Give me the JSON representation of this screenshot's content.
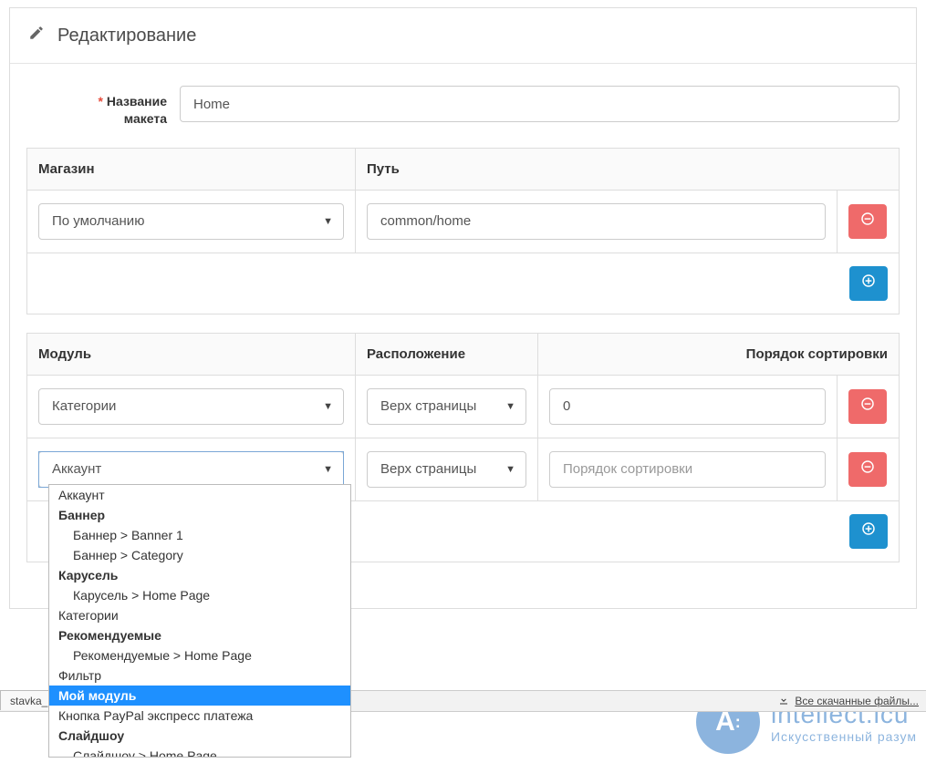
{
  "header": {
    "title": "Редактирование"
  },
  "form": {
    "name_label_line1": "Название",
    "name_label_line2": "макета",
    "name_value": "Home"
  },
  "routes": {
    "headers": {
      "store": "Магазин",
      "path": "Путь"
    },
    "rows": [
      {
        "store": "По умолчанию",
        "path": "common/home"
      }
    ]
  },
  "modules": {
    "headers": {
      "module": "Модуль",
      "position": "Расположение",
      "sort": "Порядок сортировки"
    },
    "rows": [
      {
        "module": "Категории",
        "position": "Верх страницы",
        "sort": "0"
      },
      {
        "module": "Аккаунт",
        "position": "Верх страницы",
        "sort": "",
        "sort_placeholder": "Порядок сортировки"
      }
    ]
  },
  "dropdown": {
    "options": [
      {
        "label": "Аккаунт",
        "bold": false,
        "indent": false
      },
      {
        "label": "Баннер",
        "bold": true,
        "indent": false
      },
      {
        "label": "Баннер > Banner 1",
        "bold": false,
        "indent": true
      },
      {
        "label": "Баннер > Category",
        "bold": false,
        "indent": true
      },
      {
        "label": "Карусель",
        "bold": true,
        "indent": false
      },
      {
        "label": "Карусель > Home Page",
        "bold": false,
        "indent": true
      },
      {
        "label": "Категории",
        "bold": false,
        "indent": false
      },
      {
        "label": "Рекомендуемые",
        "bold": true,
        "indent": false
      },
      {
        "label": "Рекомендуемые > Home Page",
        "bold": false,
        "indent": true
      },
      {
        "label": "Фильтр",
        "bold": false,
        "indent": false
      },
      {
        "label": "Мой модуль",
        "bold": true,
        "indent": false,
        "selected": true
      },
      {
        "label": "Кнопка PayPal экспресс платежа",
        "bold": false,
        "indent": false
      },
      {
        "label": "Слайдшоу",
        "bold": true,
        "indent": false
      },
      {
        "label": "Слайдшоу > Home Page",
        "bold": false,
        "indent": true
      }
    ]
  },
  "bottom": {
    "tab": "stavka_k...",
    "downloads": "Все скачанные файлы..."
  },
  "watermark": {
    "brand": "intellect.icu",
    "tagline": "Искусственный разум",
    "initials": "A"
  }
}
